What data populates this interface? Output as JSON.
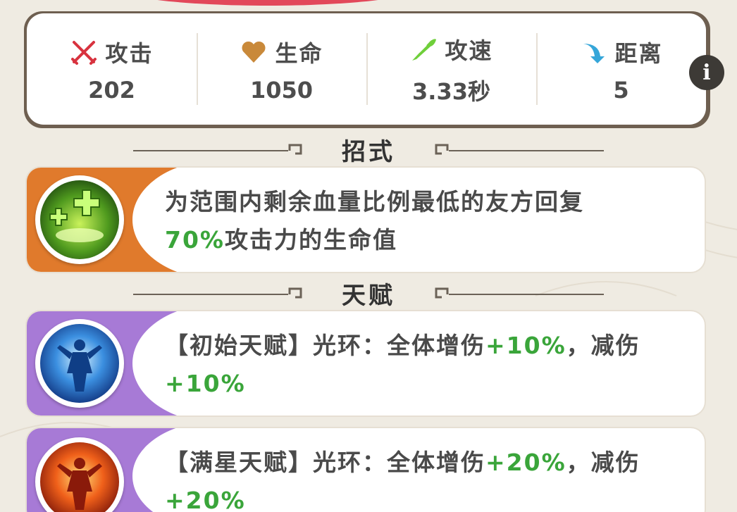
{
  "stats": [
    {
      "icon": "crossed-swords-icon",
      "label": "攻击",
      "value": "202"
    },
    {
      "icon": "heart-icon",
      "label": "生命",
      "value": "1050"
    },
    {
      "icon": "wing-speed-icon",
      "label": "攻速",
      "value": "3.33秒"
    },
    {
      "icon": "range-arrow-icon",
      "label": "距离",
      "value": "5"
    }
  ],
  "info_button": {
    "icon": "info-icon",
    "glyph": "i"
  },
  "sections": {
    "moves": {
      "title": "招式"
    },
    "talents": {
      "title": "天赋"
    }
  },
  "skill": {
    "icon": "heal-cross-icon",
    "text_part1": "为范围内剩余血量比例最低的友方回复",
    "highlight": "70%",
    "text_part2": "攻击力的生命值"
  },
  "talents": [
    {
      "icon": "blue-aura-warrior-icon",
      "prefix": "【初始天赋】光环：全体增伤",
      "buff1": "+10%",
      "mid": "，减伤",
      "buff2": "+10%"
    },
    {
      "icon": "fire-aura-warrior-icon",
      "prefix": "【满星天赋】光环：全体增伤",
      "buff1": "+20%",
      "mid": "，减伤",
      "buff2": "+20%"
    }
  ],
  "colors": {
    "attack": "#d8333f",
    "hp": "#c9893a",
    "speed": "#6fcf3a",
    "range": "#35a6d9",
    "buff_green": "#3aa53a",
    "skill_band": "#e07a2c",
    "talent_band": "#a77ad6"
  }
}
